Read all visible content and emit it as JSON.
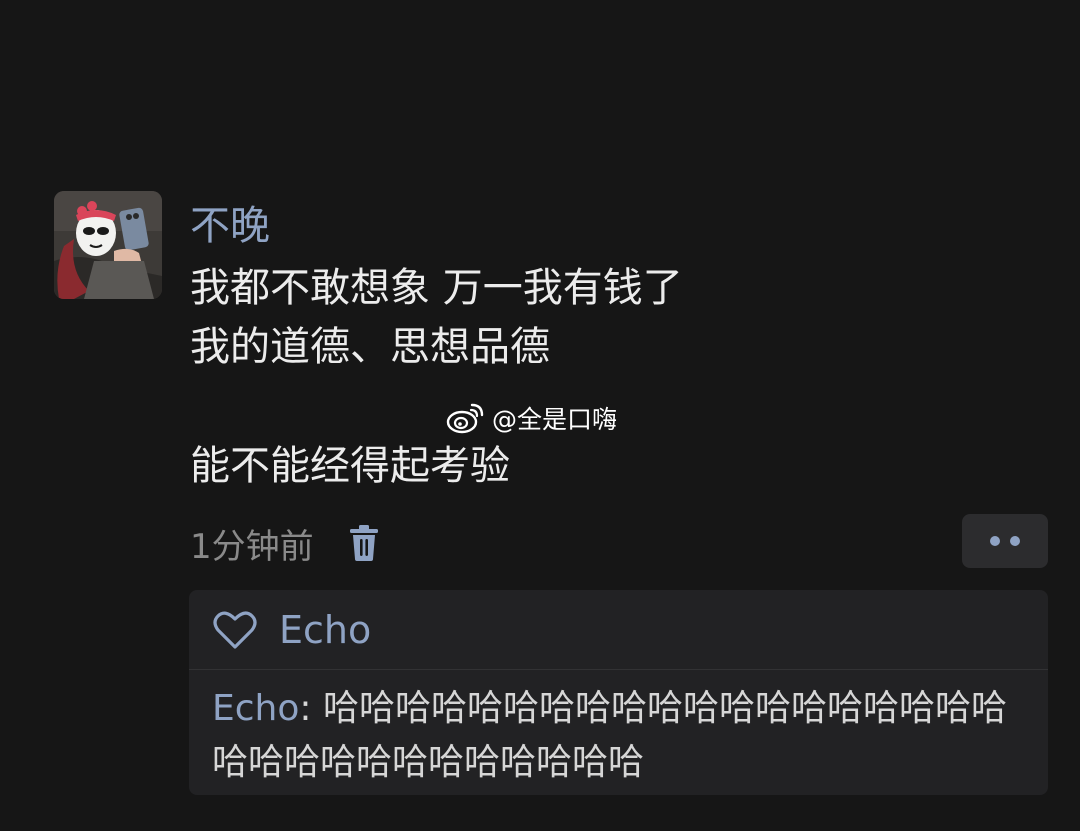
{
  "post": {
    "username": "不晚",
    "content_lines": [
      "我都不敢想象 万一我有钱了",
      "我的道德、思想品德",
      "能不能经得起考验"
    ],
    "timestamp": "1分钟前",
    "icons": {
      "avatar": "avatar-image",
      "delete": "trash-icon",
      "more": "more-dots-icon"
    }
  },
  "watermark": {
    "text": "@全是口嗨",
    "icon": "weibo-logo-icon"
  },
  "reply_section": {
    "like_icon": "heart-icon",
    "liked_by": "Echo",
    "reply": {
      "author": "Echo",
      "separator": ": ",
      "text": "哈哈哈哈哈哈哈哈哈哈哈哈哈哈哈哈哈哈哈哈哈哈哈哈哈哈哈哈哈哈哈"
    }
  },
  "colors": {
    "background": "#161616",
    "accent_blue": "#8fa3c4",
    "text_primary": "#ececec",
    "text_secondary": "#8a8a8a",
    "panel": "#222224",
    "button": "#2c2c2e"
  }
}
